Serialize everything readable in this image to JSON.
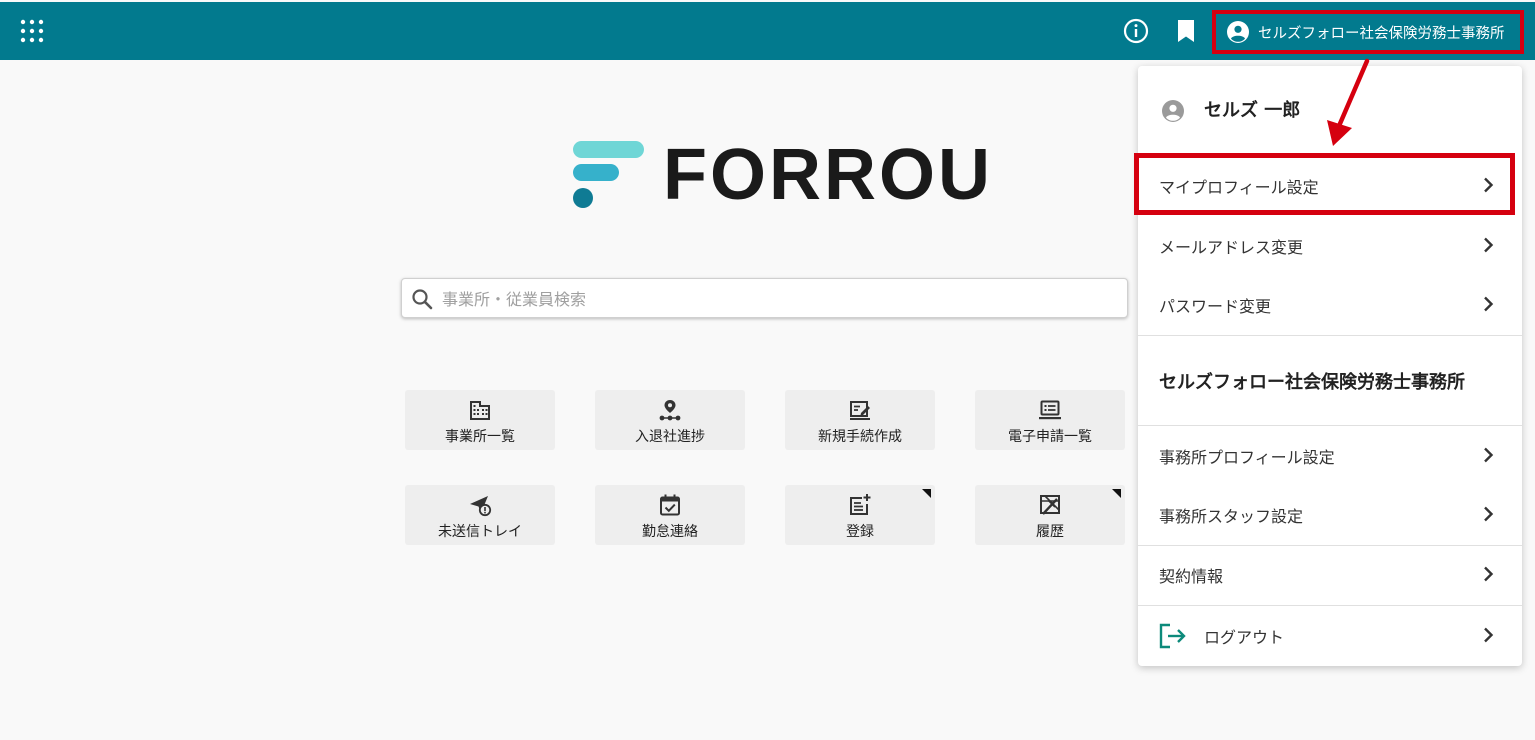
{
  "header": {
    "account_label": "セルズフォロー社会保険労務士事務所",
    "colors": {
      "bar": "#027a8e",
      "highlight": "#d5000f"
    },
    "icons": [
      "app-grid-icon",
      "info-icon",
      "bookmark-icon",
      "account-circle-icon"
    ]
  },
  "logo": {
    "text": "FORROU"
  },
  "search": {
    "placeholder": "事業所・従業員検索",
    "value": ""
  },
  "tiles": [
    {
      "label": "事業所一覧",
      "icon": "building-icon"
    },
    {
      "label": "入退社進捗",
      "icon": "progress-route-icon"
    },
    {
      "label": "新規手続作成",
      "icon": "edit-note-icon"
    },
    {
      "label": "電子申請一覧",
      "icon": "laptop-list-icon"
    },
    {
      "label": "未送信トレイ",
      "icon": "unsent-send-icon"
    },
    {
      "label": "勤怠連絡",
      "icon": "calendar-check-icon"
    },
    {
      "label": "登録",
      "icon": "note-add-icon"
    },
    {
      "label": "履歴",
      "icon": "history-icon"
    }
  ],
  "account_menu": {
    "user_name": "セルズ 一郎",
    "items_personal": [
      {
        "label": "マイプロフィール設定"
      },
      {
        "label": "メールアドレス変更"
      },
      {
        "label": "パスワード変更"
      }
    ],
    "office_name": "セルズフォロー社会保険労務士事務所",
    "items_office": [
      {
        "label": "事務所プロフィール設定"
      },
      {
        "label": "事務所スタッフ設定"
      }
    ],
    "contract_label": "契約情報",
    "logout_label": "ログアウト"
  }
}
